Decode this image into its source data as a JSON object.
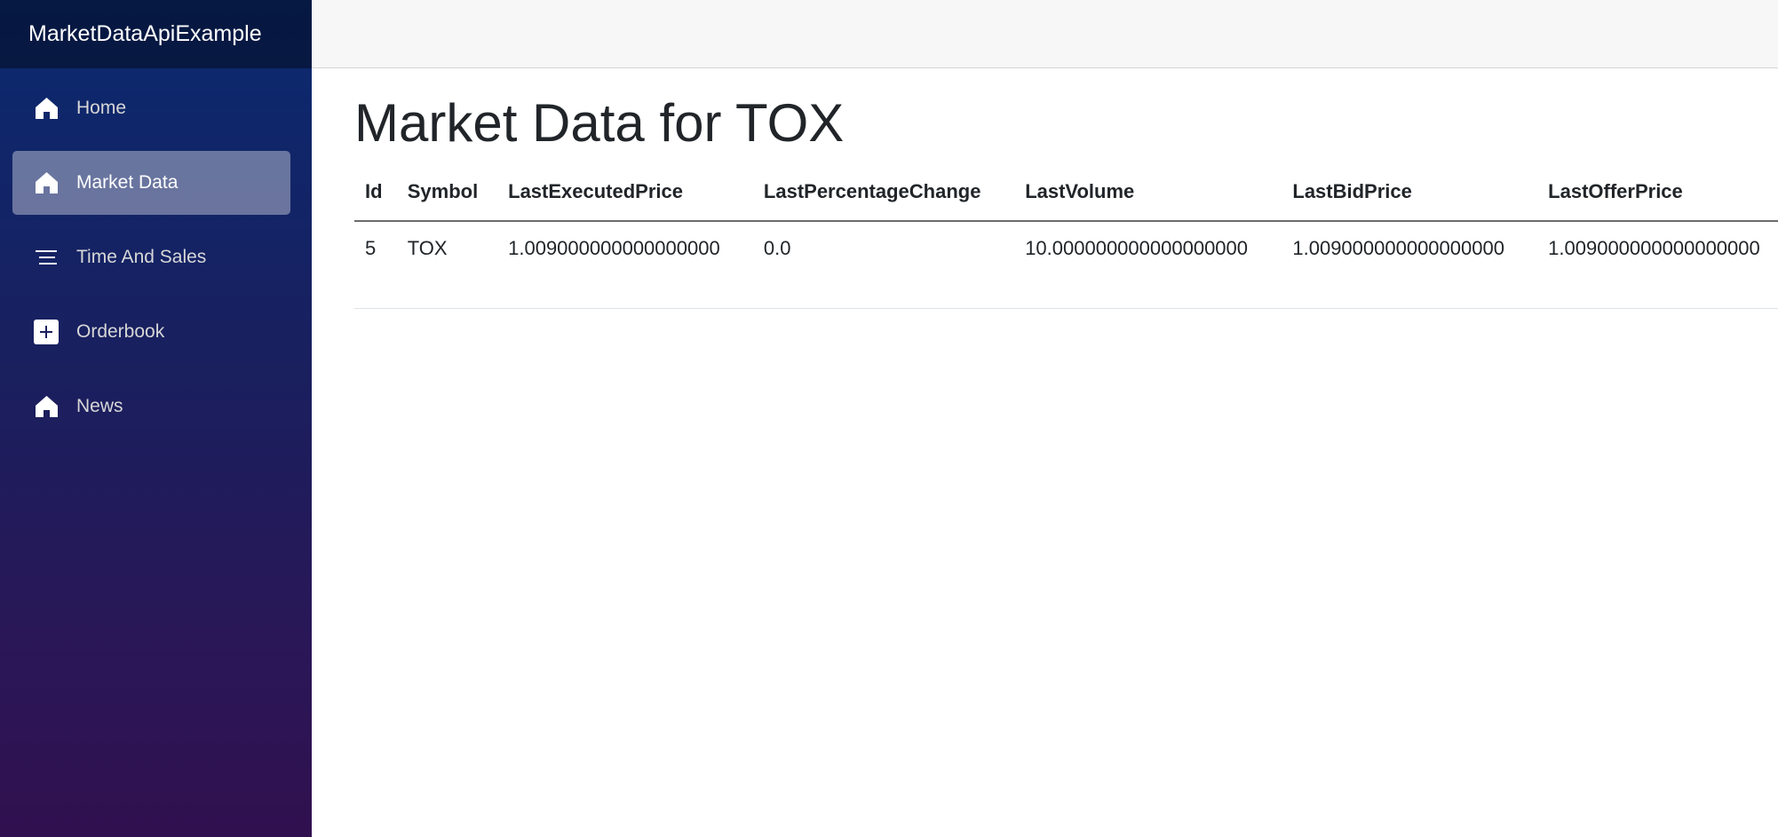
{
  "app": {
    "brand": "MarketDataApiExample"
  },
  "sidebar": {
    "items": [
      {
        "label": "Home",
        "icon": "home-icon"
      },
      {
        "label": "Market Data",
        "icon": "home-icon",
        "active": true
      },
      {
        "label": "Time And Sales",
        "icon": "list-icon"
      },
      {
        "label": "Orderbook",
        "icon": "plus-icon"
      },
      {
        "label": "News",
        "icon": "home-icon"
      }
    ]
  },
  "main": {
    "title": "Market Data for TOX",
    "table": {
      "headers": [
        "Id",
        "Symbol",
        "LastExecutedPrice",
        "LastPercentageChange",
        "LastVolume",
        "LastBidPrice",
        "LastOfferPrice"
      ],
      "rows": [
        [
          "5",
          "TOX",
          "1.009000000000000000",
          "0.0",
          "10.000000000000000000",
          "1.009000000000000000",
          "1.009000000000000000"
        ]
      ]
    }
  },
  "colors": {
    "sidebar_gradient_top": "#0a2a70",
    "sidebar_gradient_bottom": "#31104f",
    "active_item_bg": "#6b7299",
    "topbar_bg": "#f7f7f7",
    "text": "#212529"
  }
}
